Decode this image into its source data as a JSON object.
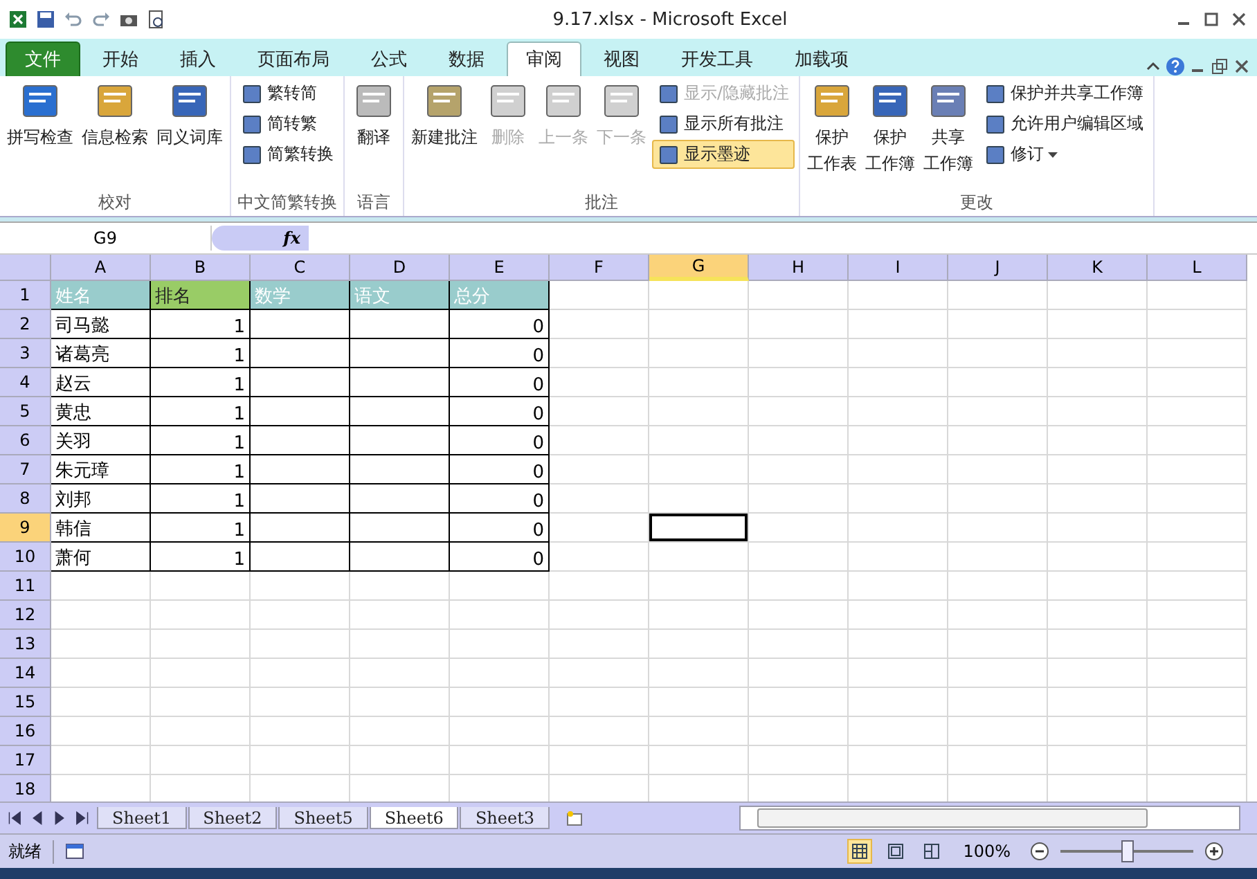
{
  "window": {
    "title": "9.17.xlsx  -  Microsoft Excel"
  },
  "ribbon_tabs": [
    {
      "label": "文件",
      "kind": "file",
      "selected": false
    },
    {
      "label": "开始",
      "kind": "tab",
      "selected": false
    },
    {
      "label": "插入",
      "kind": "tab",
      "selected": false
    },
    {
      "label": "页面布局",
      "kind": "tab",
      "selected": false
    },
    {
      "label": "公式",
      "kind": "tab",
      "selected": false
    },
    {
      "label": "数据",
      "kind": "tab",
      "selected": false
    },
    {
      "label": "审阅",
      "kind": "tab",
      "selected": true
    },
    {
      "label": "视图",
      "kind": "tab",
      "selected": false
    },
    {
      "label": "开发工具",
      "kind": "tab",
      "selected": false
    },
    {
      "label": "加载项",
      "kind": "tab",
      "selected": false
    }
  ],
  "ribbon_groups": [
    {
      "label": "校对",
      "items": [
        {
          "kind": "large",
          "lines": [
            "拼写检查"
          ],
          "disabled": false
        },
        {
          "kind": "large",
          "lines": [
            "信息检索"
          ],
          "disabled": false
        },
        {
          "kind": "large",
          "lines": [
            "同义词库"
          ],
          "disabled": false
        }
      ]
    },
    {
      "label": "中文简繁转换",
      "items": [
        {
          "kind": "small",
          "lines": [
            "繁转简"
          ],
          "disabled": false
        },
        {
          "kind": "small",
          "lines": [
            "简转繁"
          ],
          "disabled": false
        },
        {
          "kind": "small",
          "lines": [
            "简繁转换"
          ],
          "disabled": false
        }
      ]
    },
    {
      "label": "语言",
      "items": [
        {
          "kind": "large",
          "lines": [
            "翻译"
          ],
          "disabled": false
        }
      ]
    },
    {
      "label": "批注",
      "items": [
        {
          "kind": "large",
          "lines": [
            "新建批注"
          ],
          "disabled": false
        },
        {
          "kind": "large",
          "lines": [
            "删除"
          ],
          "disabled": true
        },
        {
          "kind": "large",
          "lines": [
            "上一条"
          ],
          "disabled": true
        },
        {
          "kind": "large",
          "lines": [
            "下一条"
          ],
          "disabled": true
        },
        {
          "kind": "small",
          "lines": [
            "显示/隐藏批注"
          ],
          "disabled": true
        },
        {
          "kind": "small",
          "lines": [
            "显示所有批注"
          ],
          "disabled": false
        },
        {
          "kind": "small",
          "lines": [
            "显示墨迹"
          ],
          "disabled": false,
          "selected": true
        }
      ]
    },
    {
      "label": "更改",
      "items": [
        {
          "kind": "large",
          "lines": [
            "保护",
            "工作表"
          ],
          "disabled": false
        },
        {
          "kind": "large",
          "lines": [
            "保护",
            "工作簿"
          ],
          "disabled": false
        },
        {
          "kind": "large",
          "lines": [
            "共享",
            "工作簿"
          ],
          "disabled": false
        },
        {
          "kind": "small",
          "lines": [
            "保护并共享工作簿"
          ],
          "disabled": false
        },
        {
          "kind": "small",
          "lines": [
            "允许用户编辑区域"
          ],
          "disabled": false
        },
        {
          "kind": "small",
          "lines": [
            "修订"
          ],
          "disabled": false,
          "dropdown": true
        }
      ]
    }
  ],
  "formula_bar": {
    "name_box": "G9",
    "function_button": "fx"
  },
  "columns": [
    {
      "label": "A",
      "selected": false
    },
    {
      "label": "B",
      "selected": false
    },
    {
      "label": "C",
      "selected": false
    },
    {
      "label": "D",
      "selected": false
    },
    {
      "label": "E",
      "selected": false
    },
    {
      "label": "F",
      "selected": false
    },
    {
      "label": "G",
      "selected": true
    },
    {
      "label": "H",
      "selected": false
    },
    {
      "label": "I",
      "selected": false
    },
    {
      "label": "J",
      "selected": false
    },
    {
      "label": "K",
      "selected": false
    },
    {
      "label": "L",
      "selected": false
    }
  ],
  "rows": [
    {
      "label": "1",
      "selected": false,
      "cells": [
        {
          "text": "姓名",
          "kind": "text",
          "color": "#99cccc"
        },
        {
          "text": "排名",
          "kind": "text",
          "color": "#99cc66"
        },
        {
          "text": "数学",
          "kind": "text",
          "color": "#99cccc"
        },
        {
          "text": "语文",
          "kind": "text",
          "color": "#99cccc"
        },
        {
          "text": "总分",
          "kind": "text",
          "color": "#99cccc"
        }
      ]
    },
    {
      "label": "2",
      "selected": false,
      "cells": [
        {
          "text": "司马懿",
          "kind": "text"
        },
        {
          "text": "1",
          "kind": "number"
        },
        null,
        null,
        {
          "text": "0",
          "kind": "number"
        }
      ]
    },
    {
      "label": "3",
      "selected": false,
      "cells": [
        {
          "text": "诸葛亮",
          "kind": "text"
        },
        {
          "text": "1",
          "kind": "number"
        },
        null,
        null,
        {
          "text": "0",
          "kind": "number"
        }
      ]
    },
    {
      "label": "4",
      "selected": false,
      "cells": [
        {
          "text": "赵云",
          "kind": "text"
        },
        {
          "text": "1",
          "kind": "number"
        },
        null,
        null,
        {
          "text": "0",
          "kind": "number"
        }
      ]
    },
    {
      "label": "5",
      "selected": false,
      "cells": [
        {
          "text": "黄忠",
          "kind": "text"
        },
        {
          "text": "1",
          "kind": "number"
        },
        null,
        null,
        {
          "text": "0",
          "kind": "number"
        }
      ]
    },
    {
      "label": "6",
      "selected": false,
      "cells": [
        {
          "text": "关羽",
          "kind": "text"
        },
        {
          "text": "1",
          "kind": "number"
        },
        null,
        null,
        {
          "text": "0",
          "kind": "number"
        }
      ]
    },
    {
      "label": "7",
      "selected": false,
      "cells": [
        {
          "text": "朱元璋",
          "kind": "text"
        },
        {
          "text": "1",
          "kind": "number"
        },
        null,
        null,
        {
          "text": "0",
          "kind": "number"
        }
      ]
    },
    {
      "label": "8",
      "selected": false,
      "cells": [
        {
          "text": "刘邦",
          "kind": "text"
        },
        {
          "text": "1",
          "kind": "number"
        },
        null,
        null,
        {
          "text": "0",
          "kind": "number"
        }
      ]
    },
    {
      "label": "9",
      "selected": true,
      "cells": [
        {
          "text": "韩信",
          "kind": "text"
        },
        {
          "text": "1",
          "kind": "number"
        },
        null,
        null,
        {
          "text": "0",
          "kind": "number"
        }
      ]
    },
    {
      "label": "10",
      "selected": false,
      "cells": [
        {
          "text": "萧何",
          "kind": "text"
        },
        {
          "text": "1",
          "kind": "number"
        },
        null,
        null,
        {
          "text": "0",
          "kind": "number"
        }
      ]
    },
    {
      "label": "11",
      "selected": false
    },
    {
      "label": "12",
      "selected": false
    },
    {
      "label": "13",
      "selected": false
    },
    {
      "label": "14",
      "selected": false
    },
    {
      "label": "15",
      "selected": false
    },
    {
      "label": "16",
      "selected": false
    },
    {
      "label": "17",
      "selected": false
    },
    {
      "label": "18",
      "selected": false
    }
  ],
  "sheet_tabs": [
    {
      "label": "Sheet1",
      "selected": false
    },
    {
      "label": "Sheet2",
      "selected": false
    },
    {
      "label": "Sheet5",
      "selected": false
    },
    {
      "label": "Sheet6",
      "selected": true
    },
    {
      "label": "Sheet3",
      "selected": false
    }
  ],
  "status_bar": {
    "status": "就绪",
    "zoom": "100%",
    "zoom_level": {
      "level": 0.5
    },
    "views": [
      {
        "kind": "normal",
        "selected": true
      },
      {
        "kind": "layout",
        "selected": false
      },
      {
        "kind": "break",
        "selected": false
      }
    ]
  }
}
